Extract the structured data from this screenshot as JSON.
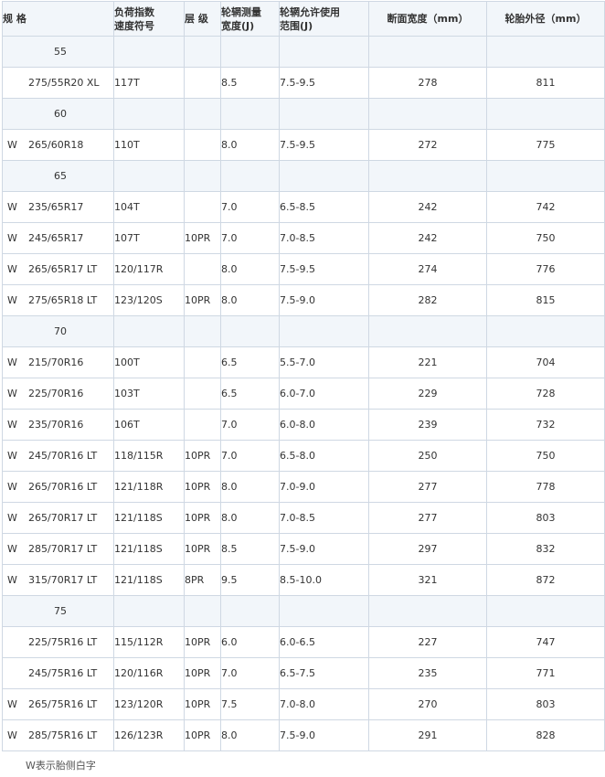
{
  "headers": {
    "spec": "规 格",
    "load_speed": "负荷指数 速度符号",
    "ply": "层 级",
    "rim_measure": "轮辋测量 宽度(J)",
    "rim_range": "轮辋允许使用 范围(J)",
    "section_width": "断面宽度（mm）",
    "outer_diameter": "轮胎外径（mm）"
  },
  "rows": [
    {
      "group": "55"
    },
    {
      "w": "",
      "size": "275/55R20 XL",
      "load_speed": "117T",
      "ply": "",
      "rim": "8.5",
      "range": "7.5-9.5",
      "width": "278",
      "diameter": "811"
    },
    {
      "group": "60"
    },
    {
      "w": "W",
      "size": "265/60R18",
      "load_speed": "110T",
      "ply": "",
      "rim": "8.0",
      "range": "7.5-9.5",
      "width": "272",
      "diameter": "775"
    },
    {
      "group": "65"
    },
    {
      "w": "W",
      "size": "235/65R17",
      "load_speed": "104T",
      "ply": "",
      "rim": "7.0",
      "range": "6.5-8.5",
      "width": "242",
      "diameter": "742"
    },
    {
      "w": "W",
      "size": "245/65R17",
      "load_speed": "107T",
      "ply": "10PR",
      "rim": "7.0",
      "range": "7.0-8.5",
      "width": "242",
      "diameter": "750"
    },
    {
      "w": "W",
      "size": "265/65R17 LT",
      "load_speed": "120/117R",
      "ply": "",
      "rim": "8.0",
      "range": "7.5-9.5",
      "width": "274",
      "diameter": "776"
    },
    {
      "w": "W",
      "size": "275/65R18 LT",
      "load_speed": "123/120S",
      "ply": "10PR",
      "rim": "8.0",
      "range": "7.5-9.0",
      "width": "282",
      "diameter": "815"
    },
    {
      "group": "70"
    },
    {
      "w": "W",
      "size": "215/70R16",
      "load_speed": "100T",
      "ply": "",
      "rim": "6.5",
      "range": "5.5-7.0",
      "width": "221",
      "diameter": "704"
    },
    {
      "w": "W",
      "size": "225/70R16",
      "load_speed": "103T",
      "ply": "",
      "rim": "6.5",
      "range": "6.0-7.0",
      "width": "229",
      "diameter": "728"
    },
    {
      "w": "W",
      "size": "235/70R16",
      "load_speed": "106T",
      "ply": "",
      "rim": "7.0",
      "range": "6.0-8.0",
      "width": "239",
      "diameter": "732"
    },
    {
      "w": "W",
      "size": "245/70R16 LT",
      "load_speed": "118/115R",
      "ply": "10PR",
      "rim": "7.0",
      "range": "6.5-8.0",
      "width": "250",
      "diameter": "750"
    },
    {
      "w": "W",
      "size": "265/70R16 LT",
      "load_speed": "121/118R",
      "ply": "10PR",
      "rim": "8.0",
      "range": "7.0-9.0",
      "width": "277",
      "diameter": "778"
    },
    {
      "w": "W",
      "size": "265/70R17 LT",
      "load_speed": "121/118S",
      "ply": "10PR",
      "rim": "8.0",
      "range": "7.0-8.5",
      "width": "277",
      "diameter": "803"
    },
    {
      "w": "W",
      "size": "285/70R17 LT",
      "load_speed": "121/118S",
      "ply": "10PR",
      "rim": "8.5",
      "range": "7.5-9.0",
      "width": "297",
      "diameter": "832"
    },
    {
      "w": "W",
      "size": "315/70R17 LT",
      "load_speed": "121/118S",
      "ply": "8PR",
      "rim": "9.5",
      "range": "8.5-10.0",
      "width": "321",
      "diameter": "872"
    },
    {
      "group": "75"
    },
    {
      "w": "",
      "size": "225/75R16 LT",
      "load_speed": "115/112R",
      "ply": "10PR",
      "rim": "6.0",
      "range": "6.0-6.5",
      "width": "227",
      "diameter": "747"
    },
    {
      "w": "",
      "size": "245/75R16 LT",
      "load_speed": "120/116R",
      "ply": "10PR",
      "rim": "7.0",
      "range": "6.5-7.5",
      "width": "235",
      "diameter": "771"
    },
    {
      "w": "W",
      "size": "265/75R16 LT",
      "load_speed": "123/120R",
      "ply": "10PR",
      "rim": "7.5",
      "range": "7.0-8.0",
      "width": "270",
      "diameter": "803"
    },
    {
      "w": "W",
      "size": "285/75R16 LT",
      "load_speed": "126/123R",
      "ply": "10PR",
      "rim": "8.0",
      "range": "7.5-9.0",
      "width": "291",
      "diameter": "828"
    }
  ],
  "footnote": "W表示胎侧白字"
}
